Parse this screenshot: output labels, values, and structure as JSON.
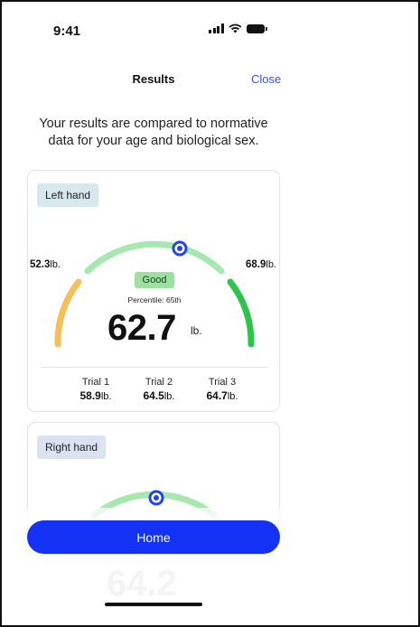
{
  "status_bar": {
    "time": "9:41",
    "icons": [
      "signal-icon",
      "wifi-icon",
      "battery-icon"
    ]
  },
  "nav": {
    "title": "Results",
    "close_label": "Close"
  },
  "intro_text": "Your results are compared to normative data for your age and biological sex.",
  "colors": {
    "accent": "#2f55f0",
    "button": "#1432f5",
    "good": "#9ee0a2",
    "gauge_low": "#f6bf57",
    "gauge_mid": "#a6e8ad",
    "gauge_high": "#2cc54a",
    "marker": "#2344e6"
  },
  "left_card": {
    "label": "Left hand",
    "low_value": "52.3",
    "high_value": "68.9",
    "unit": "lb.",
    "rating": "Good",
    "percentile_text": "Percentile: 65th",
    "percentile": 65,
    "result_value": "62.7",
    "result_unit": "lb.",
    "trials": [
      {
        "label": "Trial 1",
        "value": "58.9",
        "unit": "lb."
      },
      {
        "label": "Trial 2",
        "value": "64.5",
        "unit": "lb."
      },
      {
        "label": "Trial 3",
        "value": "64.7",
        "unit": "lb."
      }
    ]
  },
  "right_card": {
    "label": "Right hand",
    "result_value_partial": "64.2"
  },
  "home_button": "Home"
}
